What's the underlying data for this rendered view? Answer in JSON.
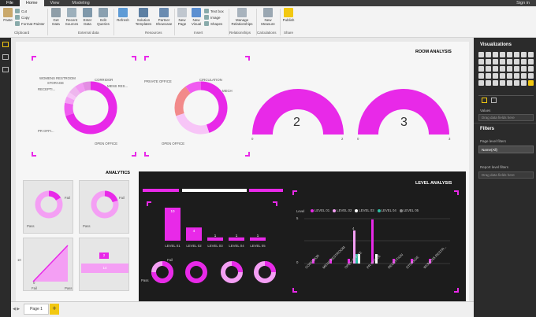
{
  "tabs": [
    {
      "label": "File"
    },
    {
      "label": "Home"
    },
    {
      "label": "View"
    },
    {
      "label": "Modeling"
    }
  ],
  "signin": "Sign in",
  "ribbon": {
    "paste": "Paste",
    "cut": "Cut",
    "copy": "Copy",
    "format_painter": "Format Painter",
    "clipboard": "Clipboard",
    "get_data": "Get Data",
    "recent_sources": "Recent Sources",
    "enter_data": "Enter Data",
    "edit_queries": "Edit Queries",
    "external_data": "External data",
    "refresh": "Refresh",
    "solution_templates": "Solution Templates",
    "partner_showcase": "Partner Showcase",
    "resources": "Resources",
    "new_page": "New Page",
    "new_visual": "New Visual",
    "text_box": "Text box",
    "image": "Image",
    "shapes": "Shapes",
    "insert": "Insert",
    "manage_relationships": "Manage Relationships",
    "relationships": "Relationships",
    "new_measure": "New Measure",
    "calculations": "Calculations",
    "publish": "Publish",
    "share": "Share"
  },
  "right_pane": {
    "visualizations": "Visualizations",
    "values": "Values",
    "drag_fields": "Drag data fields here",
    "filters": "Filters",
    "page_level_filters": "Page level filters",
    "filter_value": "Name(All)",
    "report_level_filters": "Report level filters",
    "drag_fields2": "Drag data fields here"
  },
  "report": {
    "room_analysis": "ROOM ANALYSIS",
    "analytics": "ANALYTICS",
    "level_analysis": "LEVEL ANALYSIS",
    "donut1_labels": [
      "WOMENS RESTROOM",
      "STORAGE",
      "RECEPTI...",
      "CORRIDOR",
      "MENS RES...",
      "PR OFFI...",
      "OPEN OFFICE"
    ],
    "donut2_labels": [
      "PRIVATE OFFICE",
      "CIRCULATION",
      "MECH",
      "OPEN OFFICE"
    ],
    "gauge1": {
      "value": "2",
      "min": "0",
      "max": "2"
    },
    "gauge2": {
      "value": "3",
      "min": "0",
      "max": "3"
    },
    "mini": {
      "fail1": "Fail",
      "pass1": "Pass",
      "fail2": "Fail",
      "pass2": "Pass",
      "axis10": "10",
      "axis0": "0",
      "fail3": "Fail",
      "pass3": "Pass",
      "box_top": "2",
      "box_main": "14"
    },
    "level_bar": {
      "value_labels": [
        "10",
        "4",
        "1",
        "1",
        "1"
      ],
      "categories": [
        "LEVEL 01",
        "LEVEL 02",
        "LEVEL 03",
        "LEVEL 04",
        "LEVEL 05"
      ]
    },
    "level_legend": {
      "title": "Level",
      "items": [
        "LEVEL 01",
        "LEVEL 02",
        "LEVEL 03",
        "LEVEL 04",
        "LEVEL 05"
      ]
    },
    "level_chart_ticks": [
      "5",
      "0"
    ],
    "level_chart_val4": "4",
    "level_chart_categories": [
      "CORRIDOR",
      "MENS RESTROOM",
      "OPEN OFFICE",
      "PR OFFICE",
      "RECEPTION",
      "STORAGE",
      "WOMENS RESTR..."
    ],
    "donut_row_labels": [
      "Pass",
      "Fail"
    ]
  },
  "colors": {
    "accent": "#e829e8",
    "brand_yellow": "#f2c811",
    "pink_light": "#f49ff4",
    "dark": "#1c1c1c"
  },
  "footer": {
    "page": "Page 1"
  },
  "chart_data": [
    {
      "type": "bar",
      "title": "",
      "categories": [
        "LEVEL 01",
        "LEVEL 02",
        "LEVEL 03",
        "LEVEL 04",
        "LEVEL 05"
      ],
      "values": [
        10,
        4,
        1,
        1,
        1
      ]
    },
    {
      "type": "pie",
      "title": "",
      "categories": [
        "OPEN OFFICE",
        "PR OFFI...",
        "RECEPTI...",
        "STORAGE",
        "WOMENS RESTROOM",
        "CORRIDOR",
        "MENS RES..."
      ],
      "values": [
        70,
        8,
        4,
        3,
        5,
        5,
        5
      ]
    },
    {
      "type": "pie",
      "title": "",
      "categories": [
        "OPEN OFFICE",
        "PRIVATE OFFICE",
        "CIRCULATION",
        "MECH"
      ],
      "values": [
        45,
        25,
        20,
        10
      ]
    }
  ]
}
